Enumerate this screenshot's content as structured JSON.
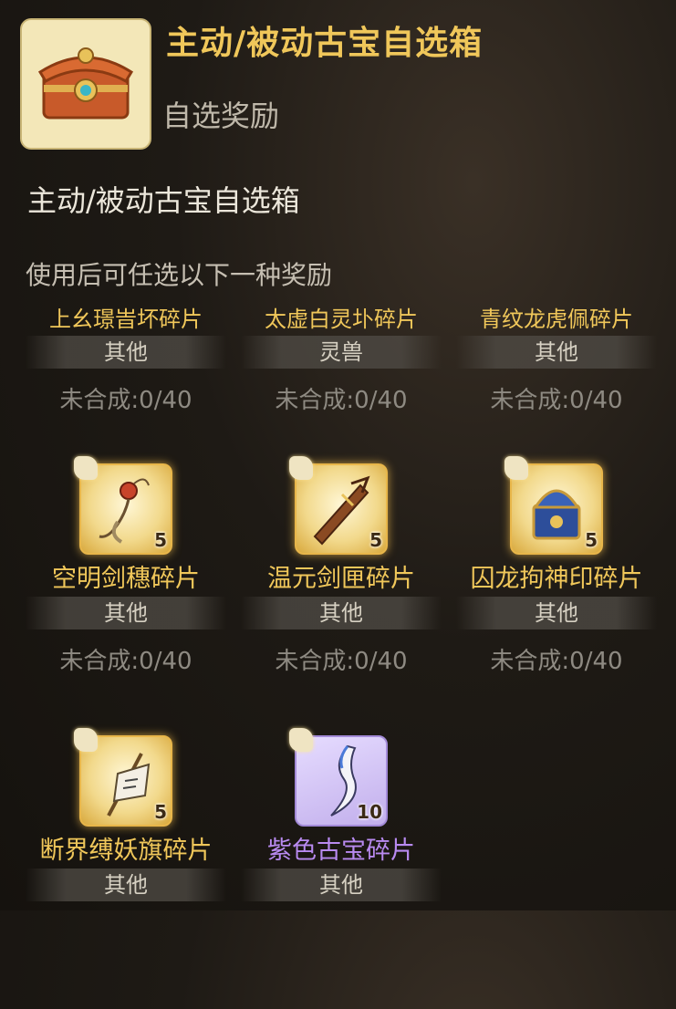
{
  "header": {
    "title": "主动/被动古宝自选箱",
    "subtitle": "自选奖励",
    "icon": "treasure-chest-icon"
  },
  "item_name": "主动/被动古宝自选箱",
  "description": "使用后可任选以下一种奖励",
  "rewards": [
    {
      "name": "上幺璟旹坏碎片",
      "tag": "其他",
      "progress": "未合成:0/40",
      "color": "gold"
    },
    {
      "name": "太虚白灵圤碎片",
      "tag": "灵兽",
      "progress": "未合成:0/40",
      "color": "gold"
    },
    {
      "name": "青纹龙虎佩碎片",
      "tag": "其他",
      "progress": "未合成:0/40",
      "color": "gold"
    },
    {
      "name": "空明剑穗碎片",
      "tag": "其他",
      "progress": "未合成:0/40",
      "badge": "5",
      "icon": "sword-tassel-icon"
    },
    {
      "name": "温元剑匣碎片",
      "tag": "其他",
      "progress": "未合成:0/40",
      "badge": "5",
      "icon": "sword-case-icon"
    },
    {
      "name": "囚龙拘神印碎片",
      "tag": "其他",
      "progress": "未合成:0/40",
      "badge": "5",
      "icon": "dragon-seal-icon"
    },
    {
      "name": "断界缚妖旗碎片",
      "tag": "其他",
      "badge": "5",
      "icon": "banner-flag-icon"
    },
    {
      "name": "紫色古宝碎片",
      "tag": "其他",
      "badge": "10",
      "icon": "purple-blade-icon"
    }
  ],
  "colors": {
    "gold": "#f0c75a",
    "purple": "#b88af0"
  }
}
